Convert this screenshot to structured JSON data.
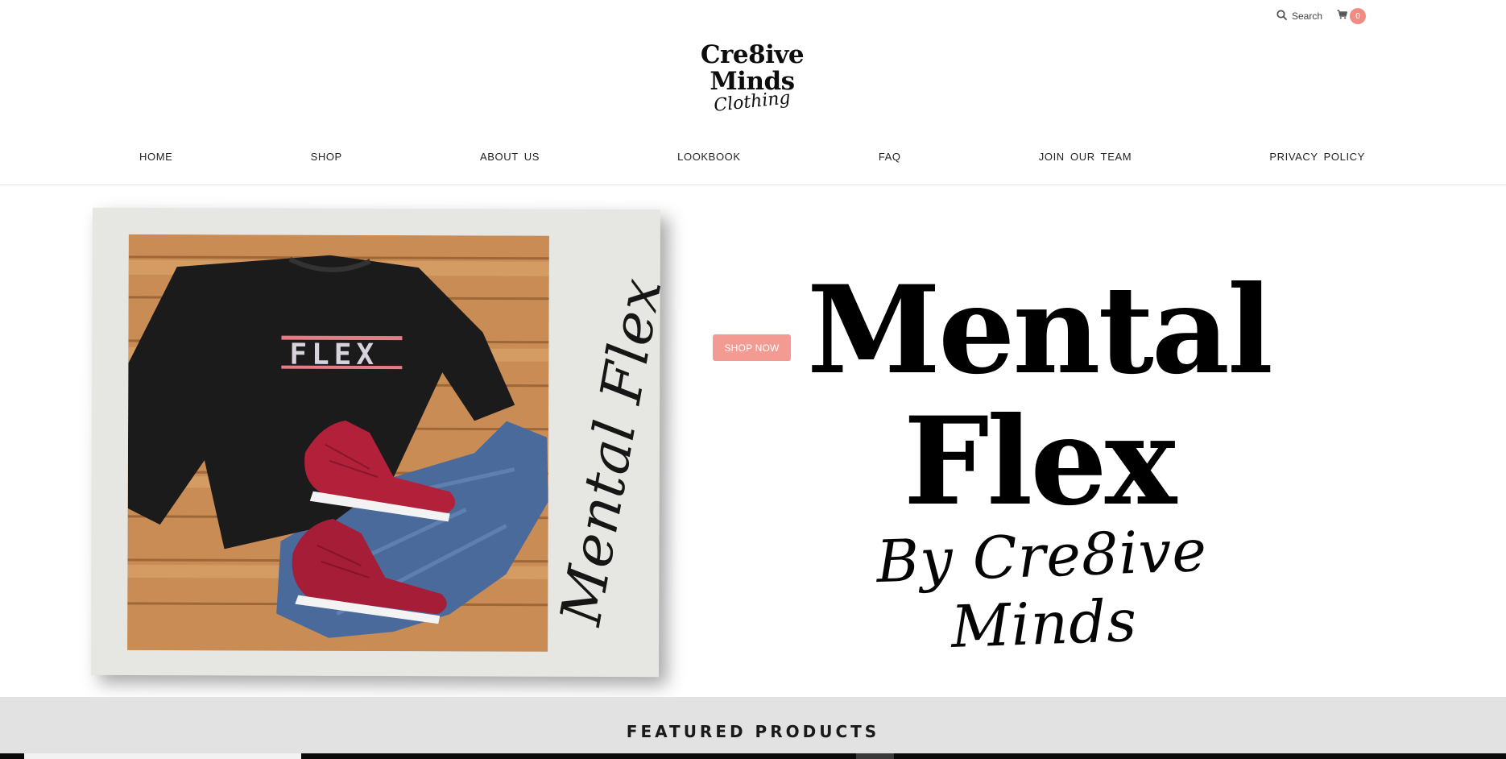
{
  "header": {
    "search_label": "Search",
    "cart_count": "0",
    "accent_color": "#f08c84"
  },
  "logo": {
    "line1": "Cre8ive",
    "line2": "Minds",
    "line3": "Clothing"
  },
  "nav": {
    "items": [
      {
        "label": "HOME"
      },
      {
        "label": "SHOP"
      },
      {
        "label": "ABOUT US"
      },
      {
        "label": "LOOKBOOK"
      },
      {
        "label": "FAQ"
      },
      {
        "label": "JOIN OUR TEAM"
      },
      {
        "label": "PRIVACY POLICY"
      }
    ]
  },
  "hero": {
    "shop_now_label": "SHOP NOW",
    "headline_line1": "Mental",
    "headline_line2": "Flex",
    "byline": "By Cre8ive Minds",
    "photo_text": "Mental Flex",
    "shirt_print": "FLEX",
    "button_color": "#f39a93"
  },
  "featured": {
    "title": "FEATURED PRODUCTS"
  }
}
